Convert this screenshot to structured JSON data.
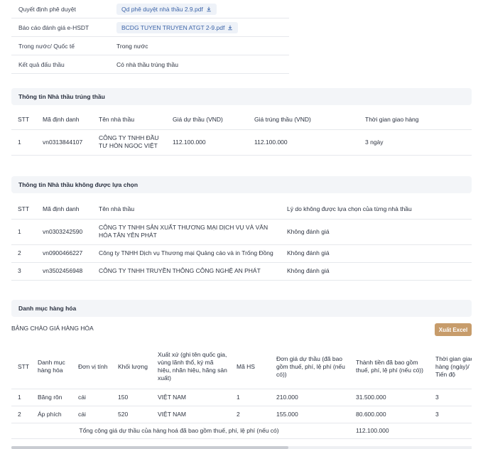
{
  "info": {
    "rows": [
      {
        "label": "Quyết định phê duyệt",
        "file": "Qd phê duyệt nhà thầu 2.9.pdf"
      },
      {
        "label": "Báo cáo đánh giá e-HSDT",
        "file": "BCDG TUYEN TRUYEN ATGT 2-9.pdf"
      },
      {
        "label": "Trong nước/ Quốc tế",
        "value": "Trong nước"
      },
      {
        "label": "Kết quả đấu thầu",
        "value": "Có nhà thầu trúng thầu"
      }
    ]
  },
  "winner": {
    "title": "Thông tin Nhà thầu trúng thầu",
    "headers": [
      "STT",
      "Mã định danh",
      "Tên nhà thầu",
      "Giá dự thầu (VND)",
      "Giá trúng thầu (VND)",
      "Thời gian giao hàng"
    ],
    "rows": [
      [
        "1",
        "vn0313844107",
        "CÔNG TY TNHH ĐẦU TƯ HÒN NGỌC VIỆT",
        "112.100.000",
        "112.100.000",
        "3 ngày"
      ]
    ]
  },
  "rejected": {
    "title": "Thông tin Nhà thầu không được lựa chọn",
    "headers": [
      "STT",
      "Mã định danh",
      "Tên nhà thầu",
      "Lý do không được lựa chọn của từng nhà thầu"
    ],
    "rows": [
      [
        "1",
        "vn0303242590",
        "CÔNG TY TNHH SẢN XUẤT THƯƠNG MẠI DỊCH VỤ VÀ VĂN HÓA TÂN YÊN PHÁT",
        "Không đánh giá"
      ],
      [
        "2",
        "vn0900466227",
        "Công ty TNHH Dịch vụ Thương mại Quảng cáo và in Trống Đồng",
        "Không đánh giá"
      ],
      [
        "3",
        "vn3502456948",
        "CÔNG TY TNHH TRUYỀN THÔNG CÔNG NGHỆ AN PHÁT",
        "Không đánh giá"
      ]
    ]
  },
  "goods": {
    "title": "Danh mục hàng hóa",
    "subtitle": "BẢNG CHÀO GIÁ HÀNG HÓA",
    "export_label": "Xuất Excel",
    "headers": [
      "STT",
      "Danh mục hàng hóa",
      "Đơn vị tính",
      "Khối lượng",
      "Xuất xứ (ghi tên quốc gia, vùng lãnh thổ, ký mã hiệu, nhãn hiệu, hãng sản xuất)",
      "Mã HS",
      "Đơn giá dự thầu (đã bao gồm thuế, phí, lệ phí (nếu có))",
      "Thành tiền đã bao gồm thuế, phí, lệ phí (nếu có))",
      "Thời gian giao hàng (ngày)/ Tiến độ"
    ],
    "rows": [
      [
        "1",
        "Băng rôn",
        "cái",
        "150",
        "VIỆT NAM",
        "1",
        "210.000",
        "31.500.000",
        "3"
      ],
      [
        "2",
        "Áp phích",
        "cái",
        "520",
        "VIỆT NAM",
        "2",
        "155.000",
        "80.600.000",
        "3"
      ]
    ],
    "total_label": "Tổng cộng giá dự thầu của hàng hoá đã bao gồm thuế, phí, lệ phí (nếu có)",
    "total_value": "112.100.000"
  }
}
